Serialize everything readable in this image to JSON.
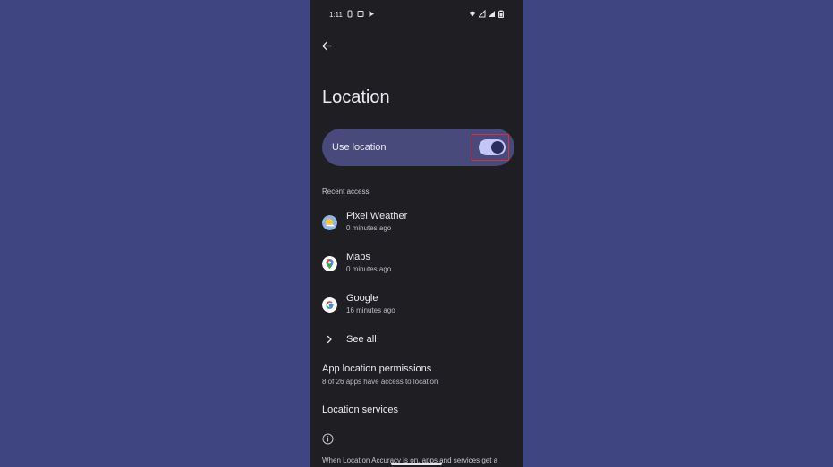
{
  "status_bar": {
    "time": "1:11",
    "left_icons": [
      "notification-icon",
      "clipboard-icon",
      "play-store-icon"
    ],
    "right_icons": [
      "wifi-icon",
      "signal-icon",
      "signal-icon",
      "battery-icon"
    ]
  },
  "header": {
    "title": "Location"
  },
  "use_location": {
    "label": "Use location",
    "enabled": true
  },
  "recent_access": {
    "label": "Recent access",
    "apps": [
      {
        "name": "Pixel Weather",
        "time": "0 minutes ago",
        "icon": "weather-icon"
      },
      {
        "name": "Maps",
        "time": "0 minutes ago",
        "icon": "maps-icon"
      },
      {
        "name": "Google",
        "time": "16 minutes ago",
        "icon": "google-icon"
      }
    ],
    "see_all": "See all"
  },
  "app_permissions": {
    "title": "App location permissions",
    "subtitle": "8 of 26 apps have access to location"
  },
  "location_services": {
    "title": "Location services"
  },
  "footer": {
    "text": "When Location Accuracy is on, apps and services get a"
  },
  "colors": {
    "background": "#3f4580",
    "screen": "#1f1f23",
    "card": "#474a7b",
    "toggle_track": "#c4c7f5",
    "highlight": "#d6303c"
  }
}
